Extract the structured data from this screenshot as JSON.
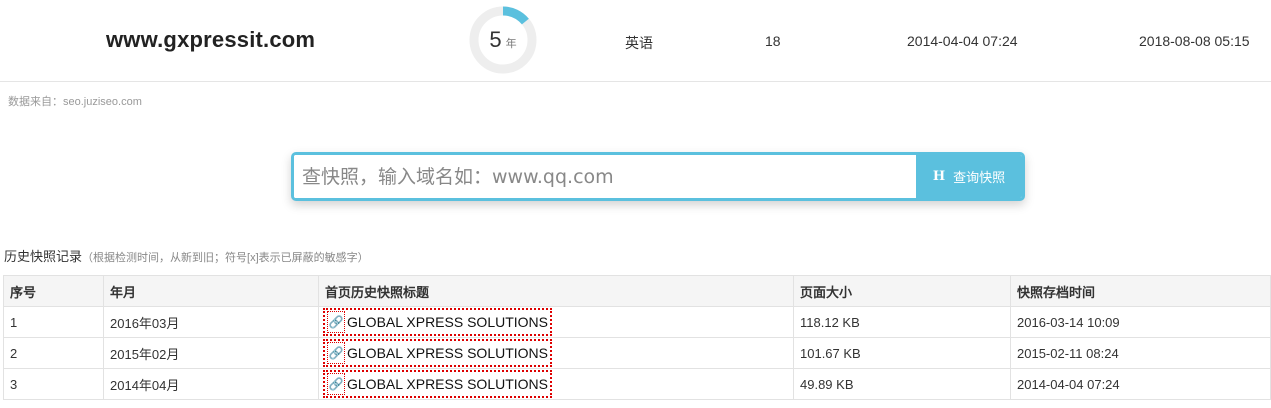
{
  "site": {
    "domain": "www.gxpressit.com",
    "age_value": "5",
    "age_unit": "年",
    "age_progress": 0.14,
    "language": "英语",
    "count": "18",
    "first_date": "2014-04-04 07:24",
    "last_date": "2018-08-08 05:15"
  },
  "source_text": "数据来自：seo.juziseo.com",
  "search": {
    "placeholder": "查快照，输入域名如：www.qq.com",
    "button_icon": "H",
    "button_label": "查询快照"
  },
  "history": {
    "title": "历史快照记录",
    "note": "（根据检测时间，从新到旧；符号[x]表示已屏蔽的敏感字）",
    "columns": [
      "序号",
      "年月",
      "首页历史快照标题",
      "页面大小",
      "快照存档时间"
    ],
    "rows": [
      {
        "index": "1",
        "month": "2016年03月",
        "title": "GLOBAL XPRESS SOLUTIONS",
        "size": "118.12 KB",
        "time": "2016-03-14 10:09"
      },
      {
        "index": "2",
        "month": "2015年02月",
        "title": "GLOBAL XPRESS SOLUTIONS",
        "size": "101.67 KB",
        "time": "2015-02-11 08:24"
      },
      {
        "index": "3",
        "month": "2014年04月",
        "title": "GLOBAL XPRESS SOLUTIONS",
        "size": "49.89 KB",
        "time": "2014-04-04 07:24"
      }
    ]
  },
  "colors": {
    "accent": "#5bc0de",
    "ring_track": "#eeeeee",
    "highlight_dotted": "#dd0000"
  },
  "icons": {
    "link": "link-icon",
    "search_button": "h-letter-icon"
  }
}
